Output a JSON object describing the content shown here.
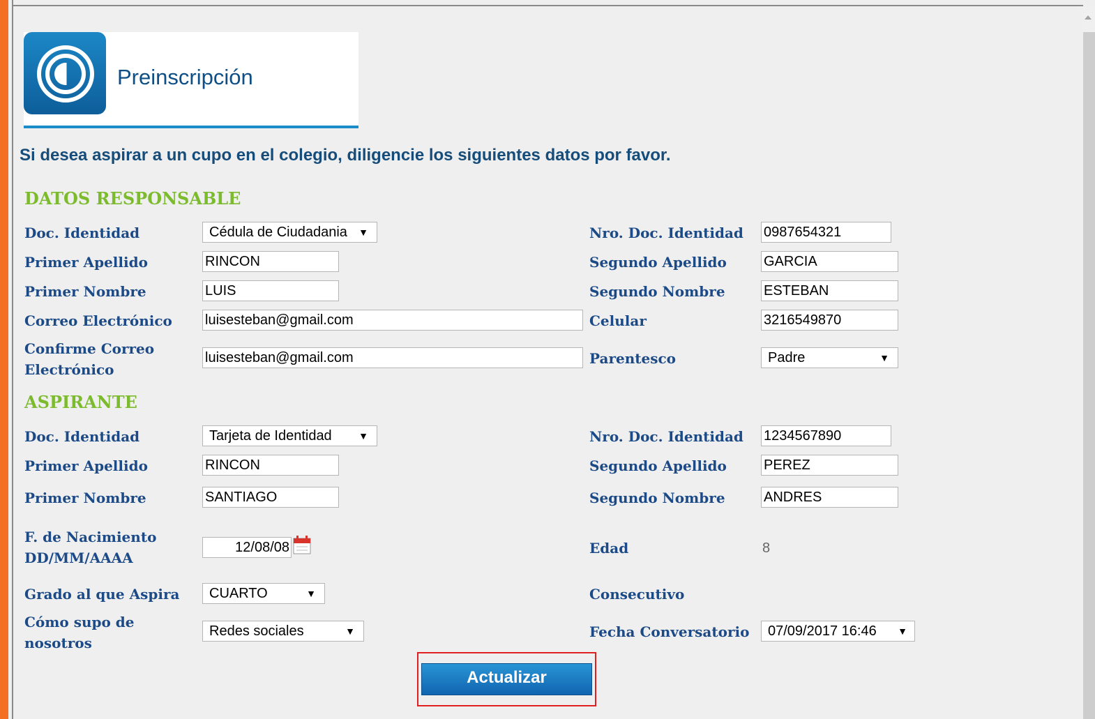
{
  "header": {
    "title": "Preinscripción"
  },
  "intro_text": "Si desea aspirar a un cupo en el colegio, diligencie los siguientes datos por favor.",
  "responsable": {
    "section_title": "DATOS RESPONSABLE",
    "doc_identidad": {
      "label": "Doc. Identidad",
      "value": "Cédula de Ciudadania"
    },
    "nro_doc": {
      "label": "Nro. Doc. Identidad",
      "value": "0987654321"
    },
    "primer_apellido": {
      "label": "Primer Apellido",
      "value": "RINCON"
    },
    "segundo_apellido": {
      "label": "Segundo Apellido",
      "value": "GARCIA"
    },
    "primer_nombre": {
      "label": "Primer Nombre",
      "value": "LUIS"
    },
    "segundo_nombre": {
      "label": "Segundo Nombre",
      "value": "ESTEBAN"
    },
    "correo": {
      "label": "Correo Electrónico",
      "value": "luisesteban@gmail.com"
    },
    "celular": {
      "label": "Celular",
      "value": "3216549870"
    },
    "confirme_correo": {
      "label_line1": "Confirme Correo",
      "label_line2": "Electrónico",
      "value": "luisesteban@gmail.com"
    },
    "parentesco": {
      "label": "Parentesco",
      "value": "Padre"
    }
  },
  "aspirante": {
    "section_title": "ASPIRANTE",
    "doc_identidad": {
      "label": "Doc. Identidad",
      "value": "Tarjeta de Identidad"
    },
    "nro_doc": {
      "label": "Nro. Doc. Identidad",
      "value": "1234567890"
    },
    "primer_apellido": {
      "label": "Primer Apellido",
      "value": "RINCON"
    },
    "segundo_apellido": {
      "label": "Segundo Apellido",
      "value": "PEREZ"
    },
    "primer_nombre": {
      "label": "Primer Nombre",
      "value": "SANTIAGO"
    },
    "segundo_nombre": {
      "label": "Segundo Nombre",
      "value": "ANDRES"
    },
    "fecha_nacimiento": {
      "label_line1": "F. de Nacimiento",
      "label_line2": "DD/MM/AAAA",
      "value": "12/08/08"
    },
    "edad": {
      "label": "Edad",
      "value": "8"
    },
    "grado": {
      "label": "Grado al que Aspira",
      "value": "CUARTO"
    },
    "consecutivo": {
      "label": "Consecutivo"
    },
    "como_supo": {
      "label_line1": "Cómo supo de",
      "label_line2": "nosotros",
      "value": "Redes sociales"
    },
    "fecha_conversatorio": {
      "label": "Fecha Conversatorio",
      "value": "07/09/2017 16:46"
    }
  },
  "actions": {
    "update_label": "Actualizar"
  },
  "icons": {
    "dropdown_arrow": "▼",
    "calendar": "calendar-icon",
    "logo": "logo-icon"
  },
  "colors": {
    "accent": "#1a8cc8",
    "section": "#7dbb2e",
    "label": "#1b4a86",
    "orange": "#f36f21"
  }
}
